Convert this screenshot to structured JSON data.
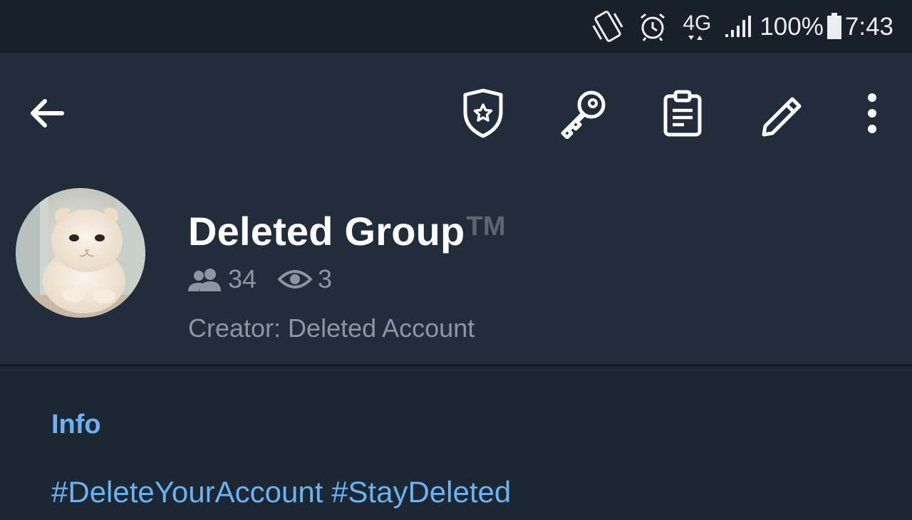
{
  "status_bar": {
    "network": "4G",
    "battery": "100%",
    "time": "7:43",
    "icons": [
      "vibrate-icon",
      "alarm-icon",
      "network-4g-icon",
      "signal-icon",
      "battery-icon"
    ]
  },
  "toolbar": {
    "icons": [
      "back-arrow-icon",
      "admin-badge-icon",
      "key-icon",
      "clipboard-icon",
      "pencil-icon",
      "more-vert-icon"
    ]
  },
  "group": {
    "name": "Deleted Group",
    "name_suffix": "TM",
    "members": "34",
    "online": "3",
    "creator": "Creator: Deleted Account"
  },
  "info": {
    "title": "Info",
    "hashtags": [
      "#DeleteYourAccount",
      "#StayDeleted"
    ]
  },
  "colors": {
    "header_bg": "#222d3c",
    "status_bg": "#18202a",
    "body_bg": "#1d2733",
    "accent": "#6ab2f2",
    "muted_text": "#8c96a1"
  }
}
